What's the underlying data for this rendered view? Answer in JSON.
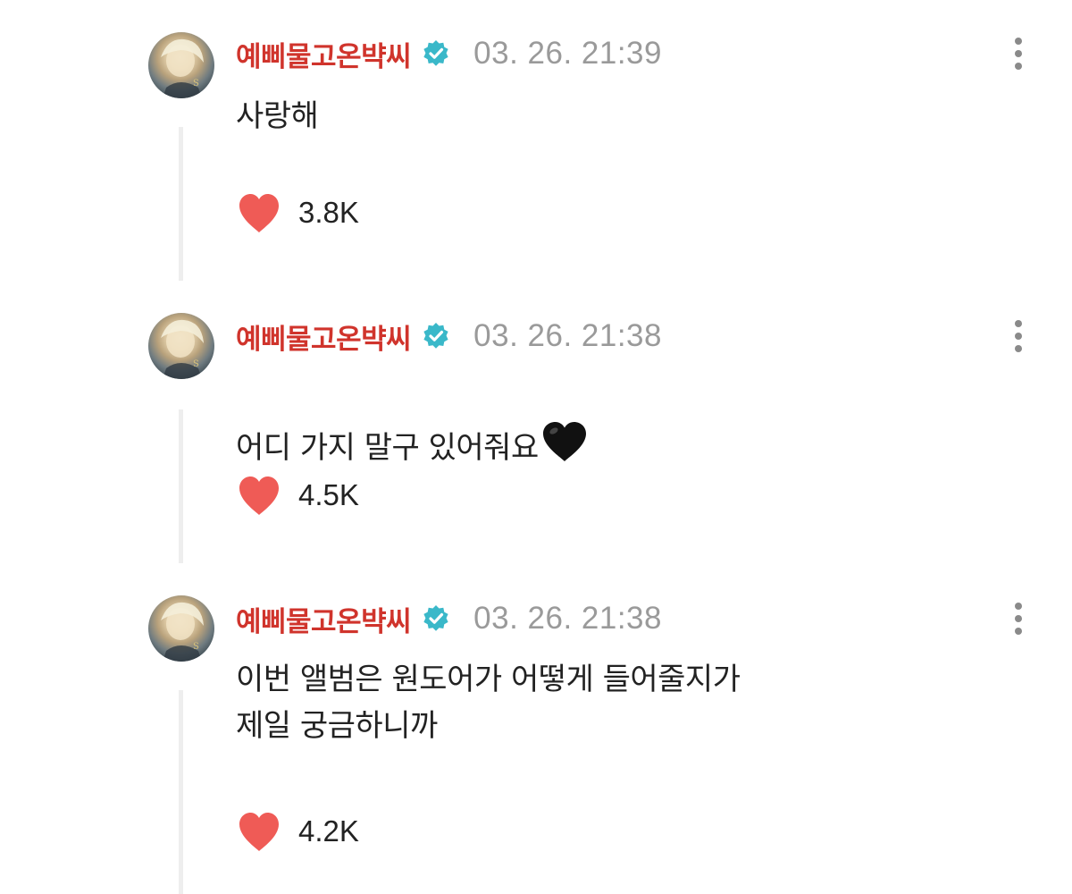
{
  "comments": [
    {
      "username": "예삐물고온뱍씨",
      "timestamp": "03. 26. 21:39",
      "text": "사랑해",
      "likes": "3.8K",
      "verified_icon": "verified-badge-icon",
      "like_icon": "heart-icon",
      "more_icon": "more-vertical-icon"
    },
    {
      "username": "예삐물고온뱍씨",
      "timestamp": "03. 26. 21:38",
      "text": "어디 가지 말구 있어줘요",
      "text_emoji": "black-heart-emoji",
      "likes": "4.5K",
      "verified_icon": "verified-badge-icon",
      "like_icon": "heart-icon",
      "more_icon": "more-vertical-icon"
    },
    {
      "username": "예삐물고온뱍씨",
      "timestamp": "03. 26. 21:38",
      "text": "이번 앨범은 원도어가 어떻게 들어줄지가\n제일 궁금하니까",
      "likes": "4.2K",
      "verified_icon": "verified-badge-icon",
      "like_icon": "heart-icon",
      "more_icon": "more-vertical-icon"
    }
  ],
  "colors": {
    "username": "#d0342c",
    "timestamp": "#9a9a9a",
    "heart": "#ef5b56",
    "verified": "#3ab8c9",
    "thread_line": "#eeeeee",
    "text": "#222222"
  }
}
